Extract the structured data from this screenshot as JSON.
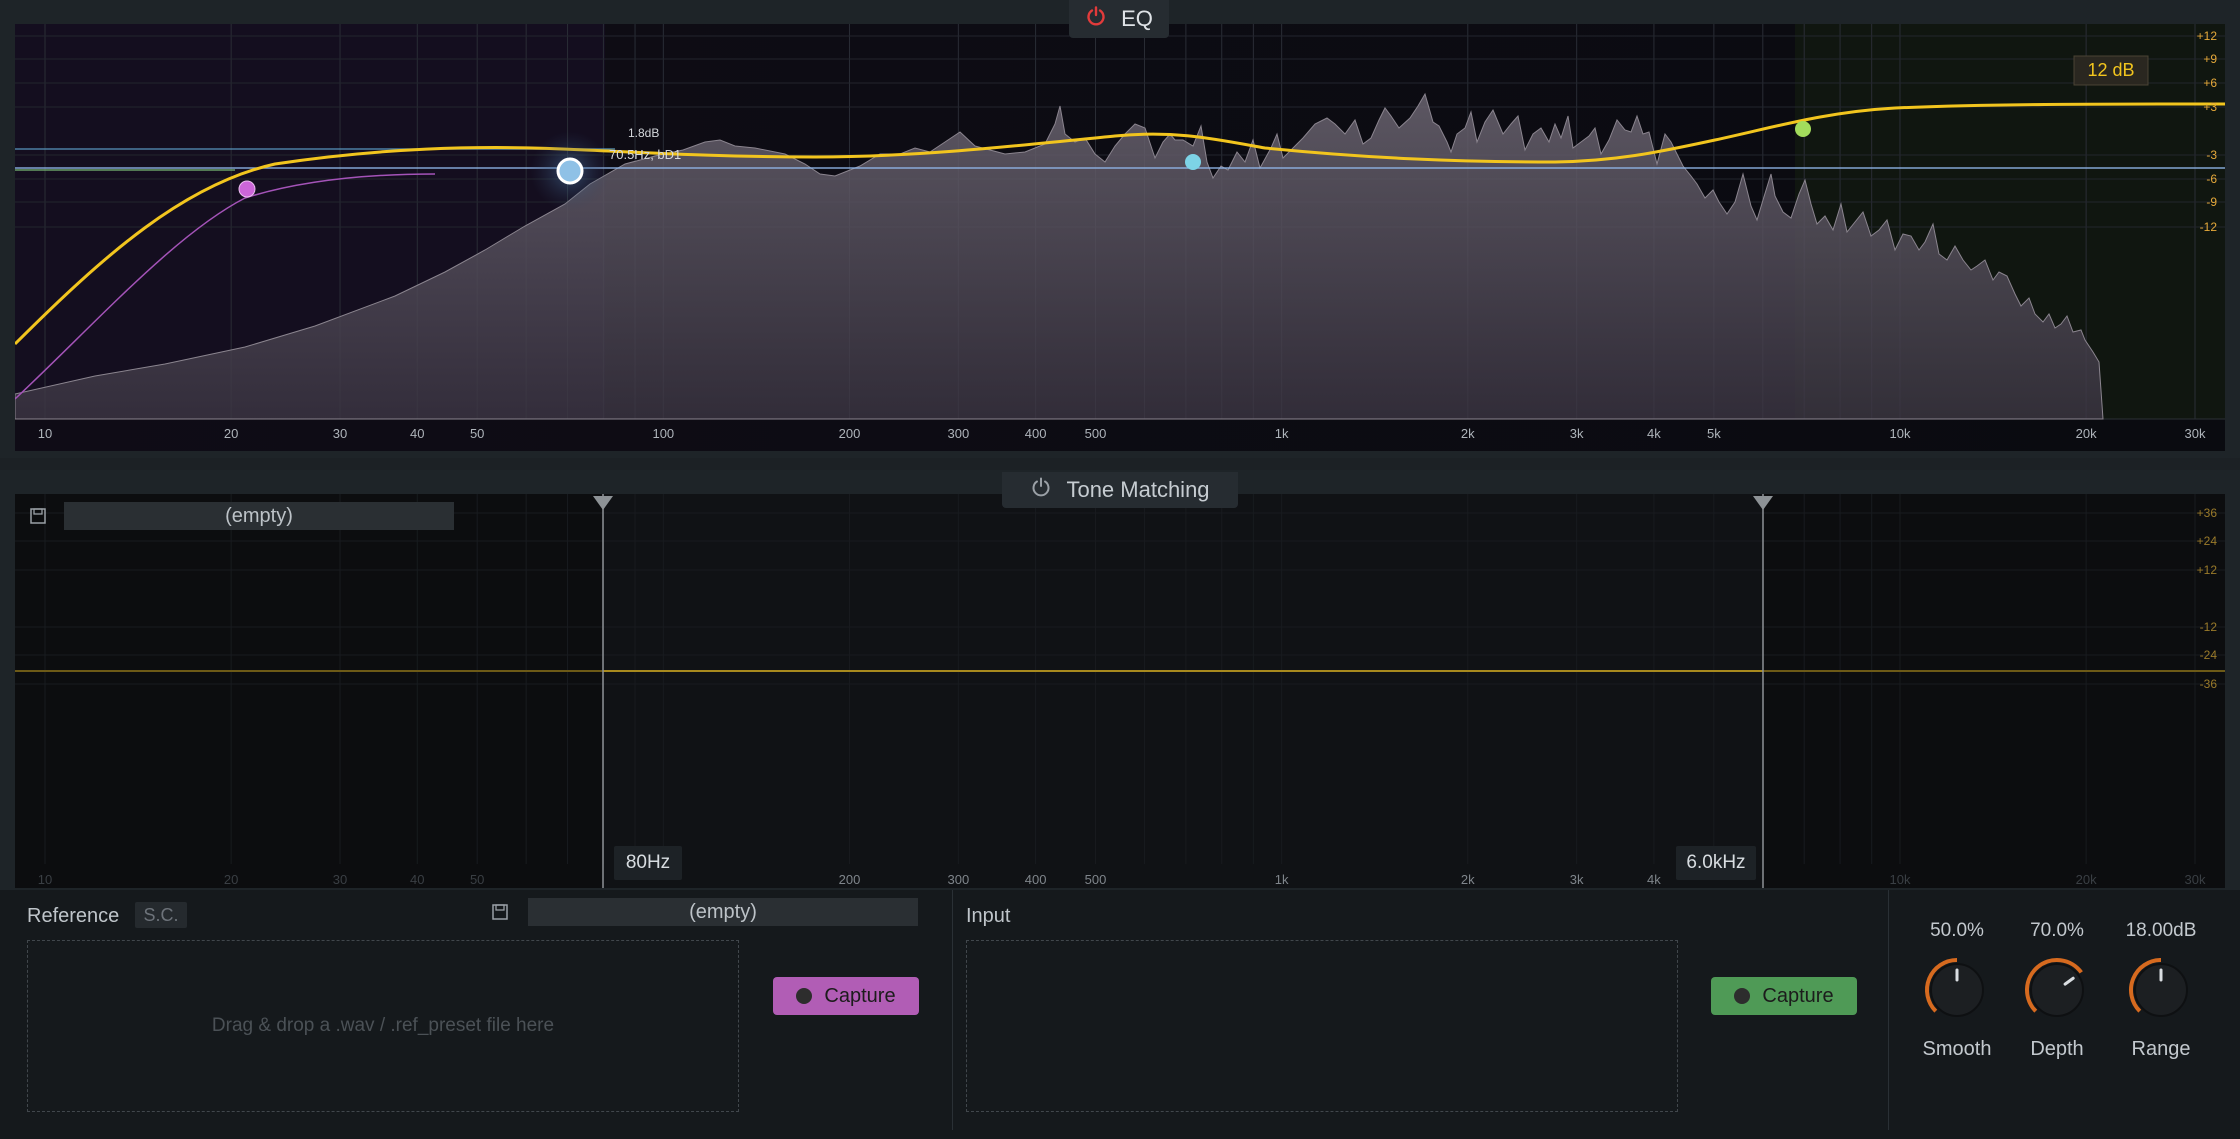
{
  "eq": {
    "title": "EQ",
    "range_button": "12 dB",
    "db_ticks": [
      "+12",
      "+9",
      "+6",
      "+3",
      "-3",
      "-6",
      "-9",
      "-12"
    ],
    "freq_ticks": [
      "10",
      "20",
      "30",
      "40",
      "50",
      "100",
      "200",
      "300",
      "400",
      "500",
      "1k",
      "2k",
      "3k",
      "4k",
      "5k",
      "10k",
      "20k",
      "30k"
    ],
    "tooltip": {
      "gain": "1.8dB",
      "freq_q": "70.5Hz, bD1"
    },
    "colors": {
      "curve": "#f2c51e",
      "node_low": "#cc66d9",
      "node_sel": "#8fc1e6",
      "node_mid": "#7dd3e6",
      "node_high": "#a3dc5c"
    }
  },
  "tone_matching": {
    "title": "Tone Matching",
    "preset_left": "(empty)",
    "db_ticks": [
      "+36",
      "+24",
      "+12",
      "-12",
      "-24",
      "-36"
    ],
    "freq_ticks": [
      "10",
      "20",
      "30",
      "40",
      "50",
      "200",
      "300",
      "400",
      "500",
      "1k",
      "2k",
      "3k",
      "4k",
      "10k",
      "20k",
      "30k"
    ],
    "low_cut": "80Hz",
    "high_cut": "6.0kHz"
  },
  "reference": {
    "label": "Reference",
    "sc": "S.C.",
    "preset": "(empty)",
    "drop_hint": "Drag & drop a .wav / .ref_preset file here",
    "capture": "Capture"
  },
  "input": {
    "label": "Input",
    "capture": "Capture"
  },
  "knobs": [
    {
      "name": "Smooth",
      "value": "50.0%",
      "level": 0.5
    },
    {
      "name": "Depth",
      "value": "70.0%",
      "level": 0.7
    },
    {
      "name": "Range",
      "value": "18.00dB",
      "level": 0.5
    }
  ]
}
